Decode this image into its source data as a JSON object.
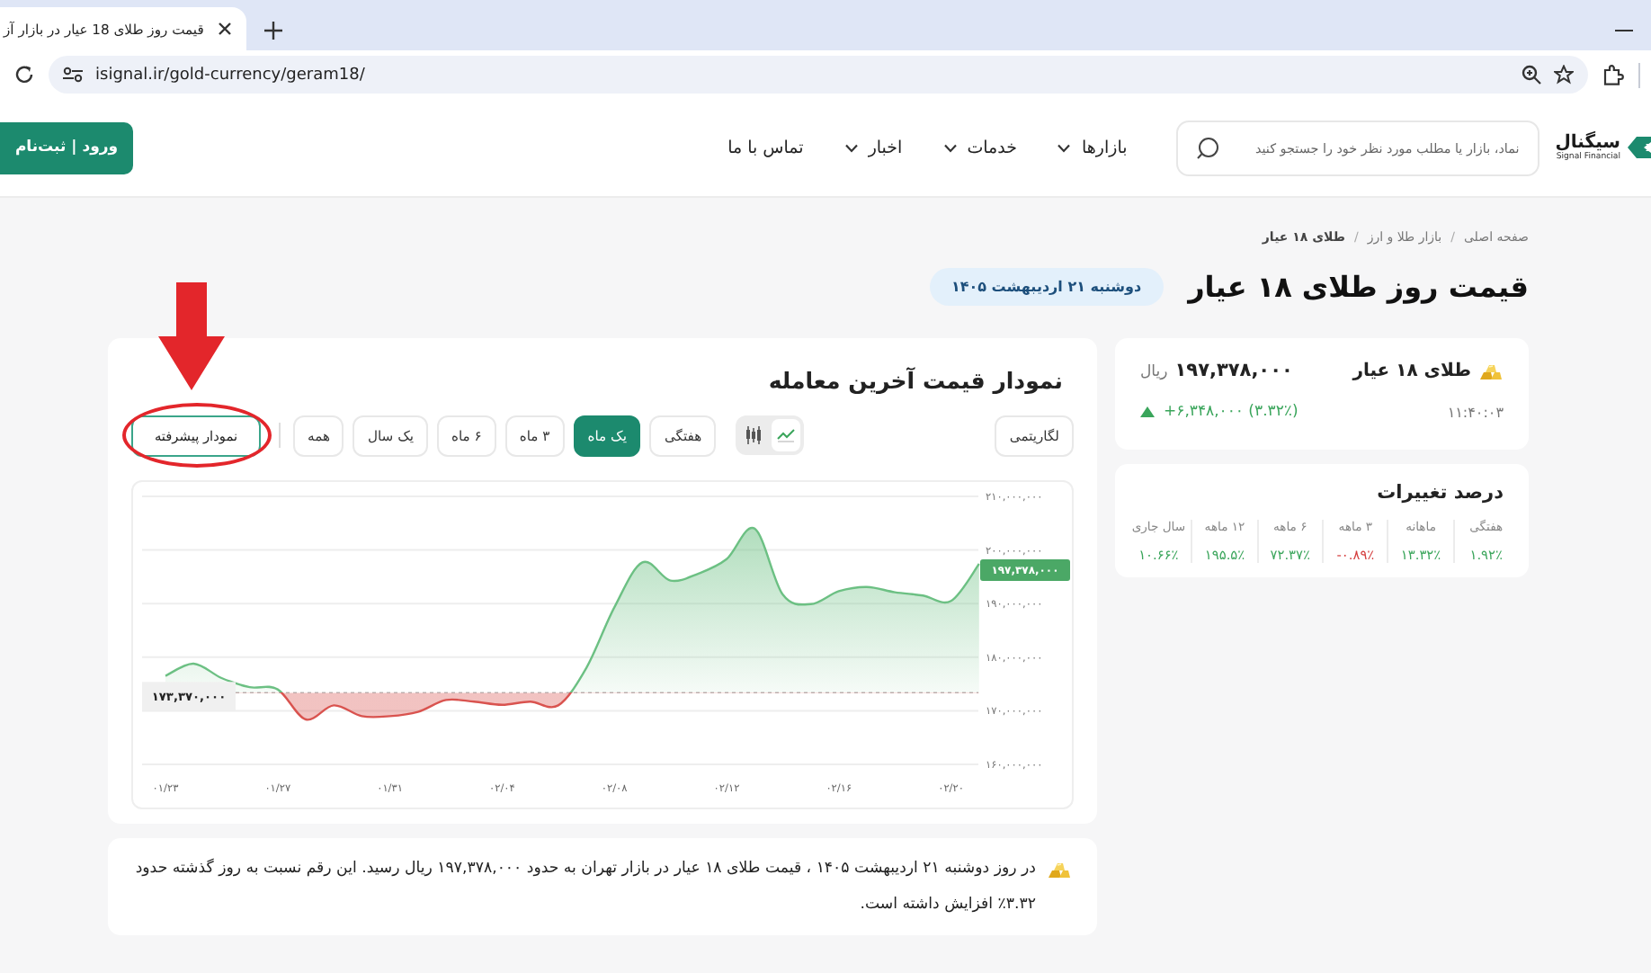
{
  "browser": {
    "tab": {
      "title": "قیمت روز طلای 18 عیار در بازار آز",
      "selected": true
    },
    "url": "isignal.ir/gold-currency/geram18/"
  },
  "header": {
    "logo": {
      "name": "سیگنال",
      "tagline": "Signal Financial"
    },
    "search": {
      "placeholder": "نماد، بازار یا مطلب مورد نظر خود را جستجو کنید"
    },
    "nav": [
      {
        "label": "بازارها",
        "has_menu": true
      },
      {
        "label": "خدمات",
        "has_menu": true
      },
      {
        "label": "اخبار",
        "has_menu": true
      },
      {
        "label": "تماس با ما",
        "has_menu": false
      }
    ],
    "login": "ورود | ثبت‌نام"
  },
  "breadcrumb": [
    {
      "label": "صفحه اصلی",
      "current": false
    },
    {
      "separator": "/",
      "label": "بازار طلا و ارز",
      "current": false
    },
    {
      "separator": "/",
      "label": "طلای ۱۸ عیار",
      "current": true
    }
  ],
  "title": "قیمت روز طلای ۱۸ عیار",
  "date": "دوشنبه ۲۱ اردیبهشت ۱۴۰۵",
  "price_card": {
    "name": "طلای ۱۸ عیار",
    "price": "۱۹۷,۳۷۸,۰۰۰",
    "unit": "ریال",
    "change": "+۶,۳۴۸,۰۰۰ (۳.۳۲٪)",
    "time": "۱۱:۴۰:۰۳"
  },
  "changes": {
    "title": "درصد تغییرات",
    "items": [
      {
        "label": "هفتگی",
        "value": "۱.۹۲٪",
        "color": "#3aa55b"
      },
      {
        "label": "ماهانه",
        "value": "۱۳.۳۲٪",
        "color": "#3aa55b"
      },
      {
        "label": "۳ ماهه",
        "value": "-۰.۸۹٪",
        "color": "#d43c3c"
      },
      {
        "label": "۶ ماهه",
        "value": "۷۲.۳۷٪",
        "color": "#3aa55b"
      },
      {
        "label": "۱۲ ماهه",
        "value": "۱۹۵.۵٪",
        "color": "#3aa55b"
      },
      {
        "label": "سال جاری",
        "value": "۱۰.۶۶٪",
        "color": "#3aa55b"
      }
    ]
  },
  "chart": {
    "title": "نمودار قیمت آخرین معامله",
    "log_toggle": {
      "label": "لگاریتمی",
      "on": false
    },
    "chart_types": [
      {
        "kind": "line",
        "selected": true
      },
      {
        "kind": "candle",
        "selected": false
      }
    ],
    "periods": [
      {
        "label": "هفتگی",
        "selected": false
      },
      {
        "label": "یک ماه",
        "selected": true
      },
      {
        "label": "۳ ماه",
        "selected": false
      },
      {
        "label": "۶ ماه",
        "selected": false
      },
      {
        "label": "یک سال",
        "selected": false
      },
      {
        "label": "همه",
        "selected": false
      }
    ],
    "advanced": {
      "label": "نمودار پیشرفته",
      "annotated": true
    },
    "last_price_tag": "۱۹۷,۳۷۸,۰۰۰",
    "chart_data": {
      "type": "area",
      "categories": [
        "۰۱/۲۳",
        null,
        null,
        null,
        "۰۱/۲۷",
        null,
        null,
        null,
        "۰۱/۳۱",
        null,
        null,
        null,
        "۰۲/۰۴",
        null,
        null,
        null,
        "۰۲/۰۸",
        null,
        null,
        null,
        "۰۲/۱۲",
        null,
        null,
        null,
        "۰۲/۱۶",
        null,
        null,
        null,
        "۰۲/۲۰",
        null
      ],
      "series": [
        {
          "color": "#6cc083",
          "values": [
            176500000,
            178800000,
            176100000,
            174400000,
            174000000,
            168400000,
            171000000,
            169000000,
            169000000,
            169800000,
            172000000,
            171700000,
            171100000,
            171700000,
            171000000,
            178000000,
            189300000,
            197700000,
            194300000,
            195600000,
            198300000,
            204000000,
            191700000,
            189900000,
            192300000,
            193100000,
            192100000,
            191500000,
            190500000,
            197400000
          ]
        }
      ],
      "ylim": [
        160000000,
        210000000
      ],
      "grid": true,
      "yticks": [
        {
          "value": 160000000,
          "label": "۱۶۰,۰۰۰,۰۰۰"
        },
        {
          "value": 170000000,
          "label": "۱۷۰,۰۰۰,۰۰۰"
        },
        {
          "value": 180000000,
          "label": "۱۸۰,۰۰۰,۰۰۰"
        },
        {
          "value": 190000000,
          "label": "۱۹۰,۰۰۰,۰۰۰"
        },
        {
          "value": 200000000,
          "label": "۲۰۰,۰۰۰,۰۰۰"
        },
        {
          "value": 210000000,
          "label": "۲۱۰,۰۰۰,۰۰۰"
        }
      ],
      "ref_lines": [
        {
          "axis": "y",
          "value": 173370000,
          "label": "۱۷۳,۳۷۰,۰۰۰"
        }
      ]
    }
  },
  "summary": "در روز دوشنبه ۲۱ اردیبهشت ۱۴۰۵ ، قیمت طلای ۱۸ عیار در بازار تهران به حدود ۱۹۷,۳۷۸,۰۰۰ ریال رسید. این رقم نسبت به روز گذشته حدود ۳.۳۲٪ افزایش داشته است."
}
